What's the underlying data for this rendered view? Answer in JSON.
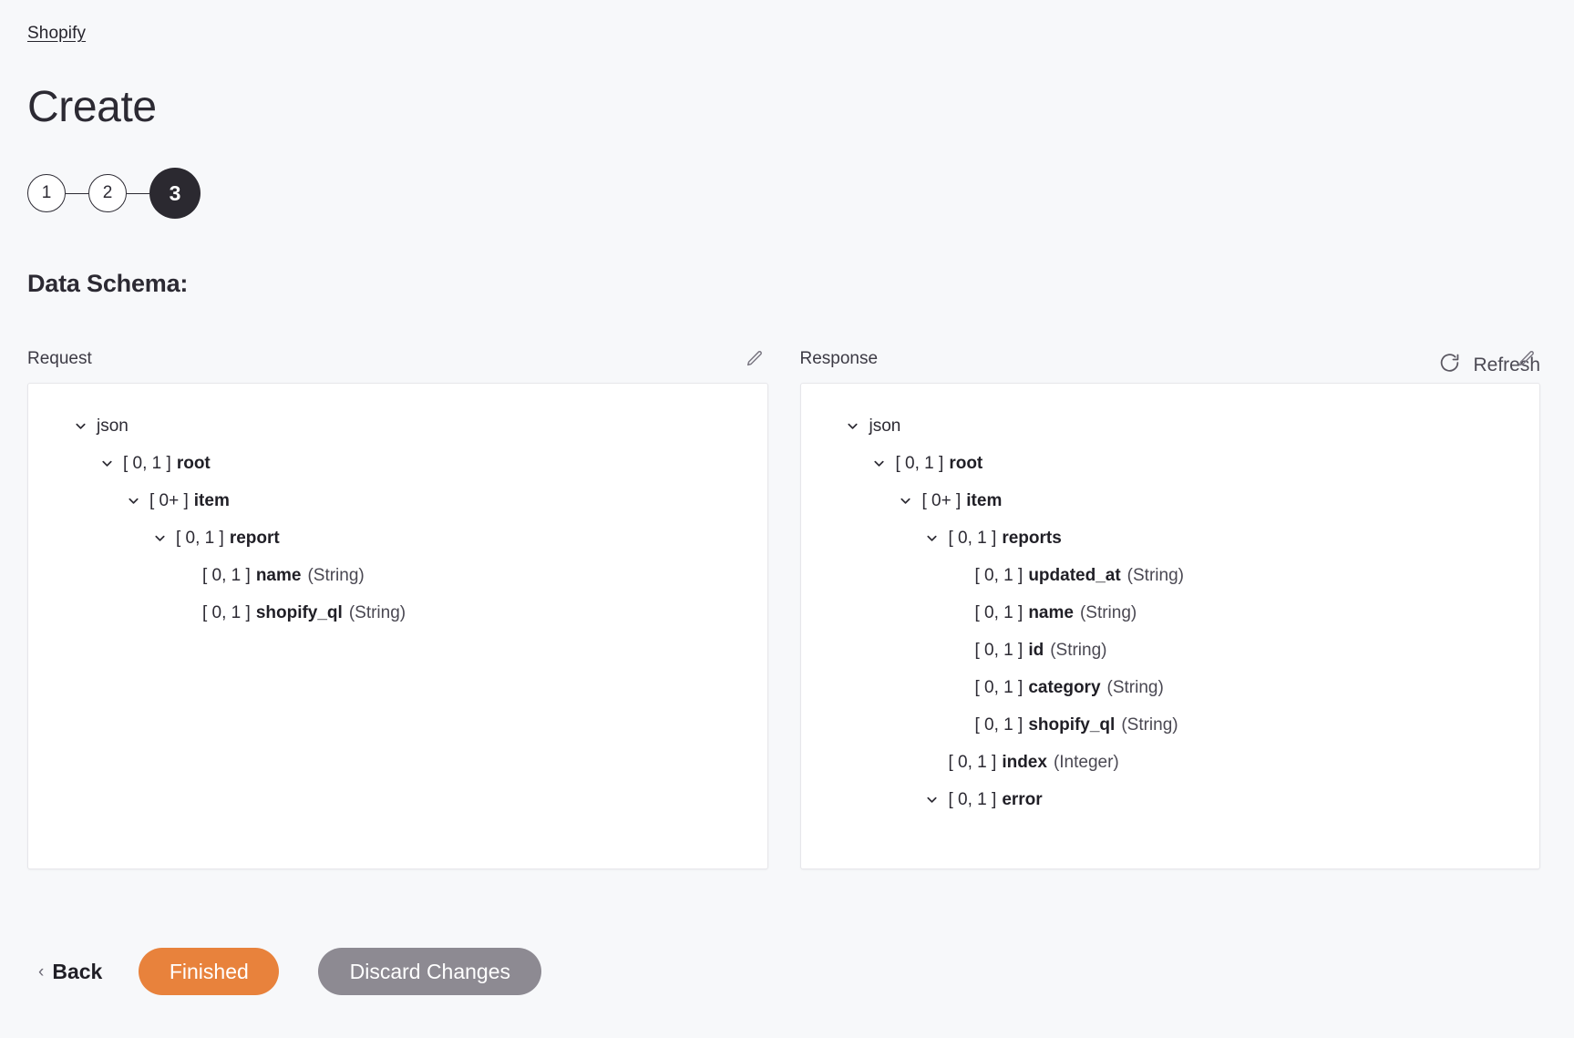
{
  "breadcrumb": {
    "label": "Shopify"
  },
  "page": {
    "title": "Create"
  },
  "stepper": {
    "steps": [
      {
        "label": "1",
        "state": "inactive"
      },
      {
        "label": "2",
        "state": "inactive"
      },
      {
        "label": "3",
        "state": "active"
      }
    ]
  },
  "section": {
    "title": "Data Schema:"
  },
  "refresh": {
    "label": "Refresh",
    "icon": "refresh-icon"
  },
  "request": {
    "label": "Request",
    "edit_icon": "pencil-icon",
    "tree": [
      {
        "indent": 0,
        "chevron": "down",
        "cardinality": "",
        "name": "json",
        "type": "",
        "bold": false
      },
      {
        "indent": 1,
        "chevron": "down",
        "cardinality": "[ 0, 1 ]",
        "name": "root",
        "type": "",
        "bold": true
      },
      {
        "indent": 2,
        "chevron": "down",
        "cardinality": "[ 0+ ]",
        "name": "item",
        "type": "",
        "bold": true
      },
      {
        "indent": 3,
        "chevron": "down",
        "cardinality": "[ 0, 1 ]",
        "name": "report",
        "type": "",
        "bold": true
      },
      {
        "indent": 4,
        "chevron": "none",
        "cardinality": "[ 0, 1 ]",
        "name": "name",
        "type": "(String)",
        "bold": true
      },
      {
        "indent": 4,
        "chevron": "none",
        "cardinality": "[ 0, 1 ]",
        "name": "shopify_ql",
        "type": "(String)",
        "bold": true
      }
    ]
  },
  "response": {
    "label": "Response",
    "edit_icon": "pencil-icon",
    "tree": [
      {
        "indent": 0,
        "chevron": "down",
        "cardinality": "",
        "name": "json",
        "type": "",
        "bold": false
      },
      {
        "indent": 1,
        "chevron": "down",
        "cardinality": "[ 0, 1 ]",
        "name": "root",
        "type": "",
        "bold": true
      },
      {
        "indent": 2,
        "chevron": "down",
        "cardinality": "[ 0+ ]",
        "name": "item",
        "type": "",
        "bold": true
      },
      {
        "indent": 3,
        "chevron": "down",
        "cardinality": "[ 0, 1 ]",
        "name": "reports",
        "type": "",
        "bold": true
      },
      {
        "indent": 4,
        "chevron": "none",
        "cardinality": "[ 0, 1 ]",
        "name": "updated_at",
        "type": "(String)",
        "bold": true
      },
      {
        "indent": 4,
        "chevron": "none",
        "cardinality": "[ 0, 1 ]",
        "name": "name",
        "type": "(String)",
        "bold": true
      },
      {
        "indent": 4,
        "chevron": "none",
        "cardinality": "[ 0, 1 ]",
        "name": "id",
        "type": "(String)",
        "bold": true
      },
      {
        "indent": 4,
        "chevron": "none",
        "cardinality": "[ 0, 1 ]",
        "name": "category",
        "type": "(String)",
        "bold": true
      },
      {
        "indent": 4,
        "chevron": "none",
        "cardinality": "[ 0, 1 ]",
        "name": "shopify_ql",
        "type": "(String)",
        "bold": true
      },
      {
        "indent": 3,
        "chevron": "none",
        "cardinality": "[ 0, 1 ]",
        "name": "index",
        "type": "(Integer)",
        "bold": true
      },
      {
        "indent": 3,
        "chevron": "down",
        "cardinality": "[ 0, 1 ]",
        "name": "error",
        "type": "",
        "bold": true
      }
    ]
  },
  "footer": {
    "back_label": "Back",
    "back_chevron": "‹",
    "finished_label": "Finished",
    "discard_label": "Discard Changes"
  },
  "colors": {
    "page_background": "#f7f8fa",
    "panel_background": "#ffffff",
    "primary_button": "#e8823c",
    "secondary_button": "#8d8a92",
    "active_step": "#2b2930",
    "text": "#2c2a33"
  }
}
